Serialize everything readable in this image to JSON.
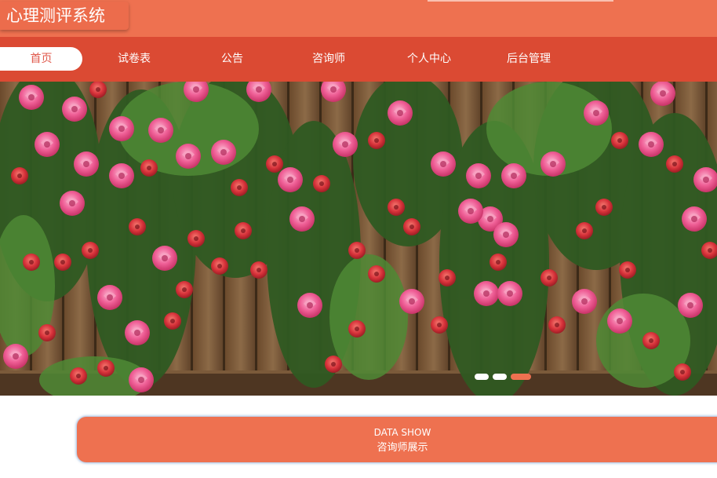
{
  "app": {
    "title": "心理测评系统"
  },
  "nav": {
    "items": [
      {
        "label": "首页",
        "active": true
      },
      {
        "label": "试卷表",
        "active": false
      },
      {
        "label": "公告",
        "active": false
      },
      {
        "label": "咨询师",
        "active": false
      },
      {
        "label": "个人中心",
        "active": false
      },
      {
        "label": "后台管理",
        "active": false
      }
    ]
  },
  "carousel": {
    "slide_count": 3,
    "active_index": 2
  },
  "section": {
    "title_en": "DATA SHOW",
    "title_cn": "咨询师展示"
  },
  "colors": {
    "header": "#ee7150",
    "nav": "#db4a33",
    "accent": "#ee7150",
    "active_nav_text": "#e0584b"
  }
}
